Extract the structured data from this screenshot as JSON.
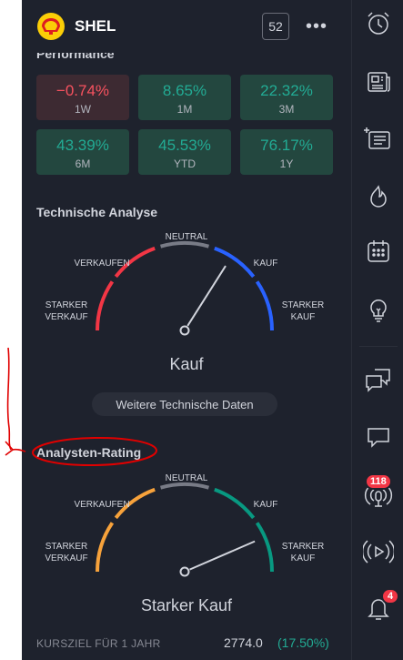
{
  "header": {
    "ticker": "SHEL",
    "count_badge": "52",
    "menu_glyph": "•••"
  },
  "performance": {
    "title": "Performance",
    "tiles": [
      {
        "value": "−0.74%",
        "label": "1W",
        "tone": "negative"
      },
      {
        "value": "8.65%",
        "label": "1M",
        "tone": "positive"
      },
      {
        "value": "22.32%",
        "label": "3M",
        "tone": "positive"
      },
      {
        "value": "43.39%",
        "label": "6M",
        "tone": "positive"
      },
      {
        "value": "45.53%",
        "label": "YTD",
        "tone": "positive"
      },
      {
        "value": "76.17%",
        "label": "1Y",
        "tone": "positive"
      }
    ]
  },
  "technical": {
    "title": "Technische Analyse",
    "labels": {
      "strong_sell_1": "STARKER",
      "strong_sell_2": "VERKAUF",
      "sell": "VERKAUFEN",
      "neutral": "NEUTRAL",
      "buy": "KAUF",
      "strong_buy_1": "STARKER",
      "strong_buy_2": "KAUF"
    },
    "result": "Kauf",
    "needle_level": 0.68,
    "more_button": "Weitere Technische Daten",
    "colors": [
      "#f23645",
      "#f23645",
      "#787b86",
      "#2962ff",
      "#2962ff"
    ]
  },
  "analyst": {
    "title": "Analysten-Rating",
    "labels": {
      "strong_sell_1": "STARKER",
      "strong_sell_2": "VERKAUF",
      "sell": "VERKAUFEN",
      "neutral": "NEUTRAL",
      "buy": "KAUF",
      "strong_buy_1": "STARKER",
      "strong_buy_2": "KAUF"
    },
    "result": "Starker Kauf",
    "needle_level": 0.87,
    "colors": [
      "#f7a23b",
      "#f7a23b",
      "#787b86",
      "#089981",
      "#089981"
    ]
  },
  "price_target": {
    "label": "KURSZIEL FÜR 1 JAHR",
    "value": "2774.0",
    "change": "(17.50%)"
  },
  "sidebar": {
    "items": [
      {
        "name": "alarm-clock-icon"
      },
      {
        "name": "news-icon"
      },
      {
        "name": "watchlist-add-icon"
      },
      {
        "name": "hotlist-flame-icon"
      },
      {
        "name": "calendar-icon"
      },
      {
        "name": "ideas-lightbulb-icon"
      },
      {
        "name": "chats-icon"
      },
      {
        "name": "chat-icon"
      },
      {
        "name": "broadcast-icon",
        "badge": "118"
      },
      {
        "name": "streams-icon"
      },
      {
        "name": "notifications-bell-icon",
        "badge": "4"
      }
    ]
  },
  "accent_colors": {
    "positive": "#22ab94",
    "negative": "#f7525f",
    "annotation": "#e00000",
    "badge": "#f23645"
  }
}
